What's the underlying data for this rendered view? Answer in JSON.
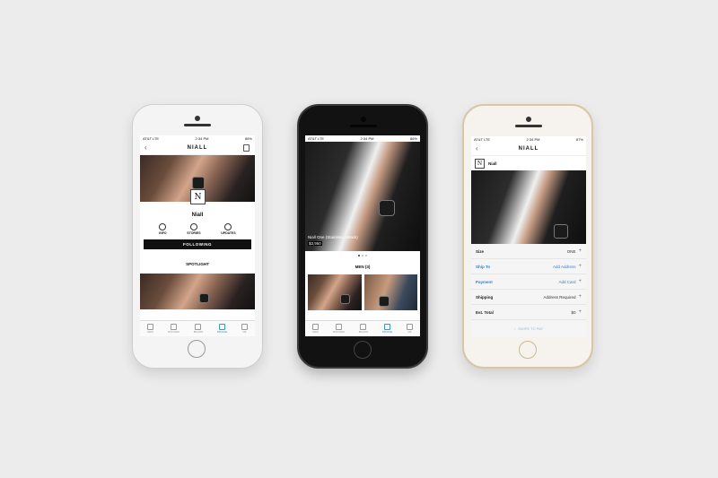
{
  "status": {
    "phone1": {
      "carrier": "AT&T  LTE",
      "time": "2:34 PM",
      "battery": "86%"
    },
    "phone2": {
      "carrier": "AT&T  LTE",
      "time": "2:34 PM",
      "battery": "86%"
    },
    "phone3": {
      "carrier": "AT&T  LTE",
      "time": "2:34 PM",
      "battery": "87%"
    }
  },
  "brand": "NIALL",
  "logo_letter": "N",
  "profile": {
    "name": "Niall",
    "actions": [
      {
        "label": "INFO",
        "icon": "info-icon"
      },
      {
        "label": "STORIES",
        "icon": "stories-icon"
      },
      {
        "label": "UPDATES",
        "icon": "updates-icon"
      }
    ],
    "follow_label": "FOLLOWING",
    "section": "SPOTLIGHT"
  },
  "product": {
    "name": "Niall One (Stainless / Black)",
    "price": "$3,950",
    "section": "MEN (3)"
  },
  "tabs": [
    {
      "label": "FEED",
      "icon": "feed-icon"
    },
    {
      "label": "DISCOVER",
      "icon": "discover-icon"
    },
    {
      "label": "BRANDS",
      "icon": "brands-icon"
    },
    {
      "label": "BROWSE",
      "icon": "browse-icon"
    },
    {
      "label": "ME",
      "icon": "profile-icon"
    }
  ],
  "checkout": {
    "seller": "Niall",
    "rows": [
      {
        "label": "Size",
        "value": "ONE"
      },
      {
        "label": "Ship To",
        "value": "Add Address"
      },
      {
        "label": "Payment",
        "value": "Add Card"
      },
      {
        "label": "Shipping",
        "value": "Address Required"
      },
      {
        "label": "Est. Total",
        "value": "$0"
      }
    ],
    "cta": "SWIPE TO PAY"
  },
  "colors": {
    "accent": "#2e9fc7",
    "link": "#3a7fc6"
  }
}
